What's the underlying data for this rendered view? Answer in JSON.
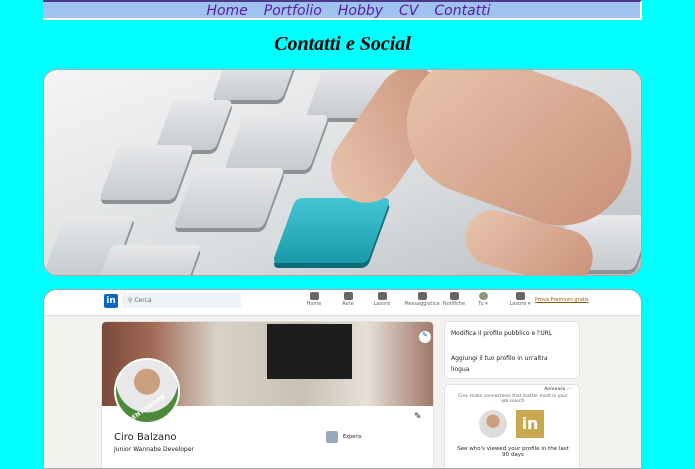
{
  "nav": [
    "Home",
    "Portfolio",
    "Hobby",
    "CV",
    "Contatti"
  ],
  "title": "Contatti e Social",
  "linkedin": {
    "logo": "in",
    "search_placeholder": "Cerca",
    "nav": [
      "Home",
      "Rete",
      "Lavoro",
      "Messaggistica",
      "Notifiche",
      "Tu ▾",
      "Lavoro ▾"
    ],
    "promo": "Prova Premium gratis",
    "profile": {
      "name": "Ciro Balzano",
      "headline": "Junior Wannabe Developer",
      "badge": "#OPENTOWORK",
      "company": "Experis"
    },
    "side1": [
      "Modifica il profilo pubblico e l'URL",
      "Aggiungi il tuo profilo in un'altra lingua"
    ],
    "ad": {
      "label": "Annuncio ···",
      "text": "Ciro, make connections that matter most in your job search",
      "footer": "See who's viewed your profile in the last 90 days"
    }
  }
}
